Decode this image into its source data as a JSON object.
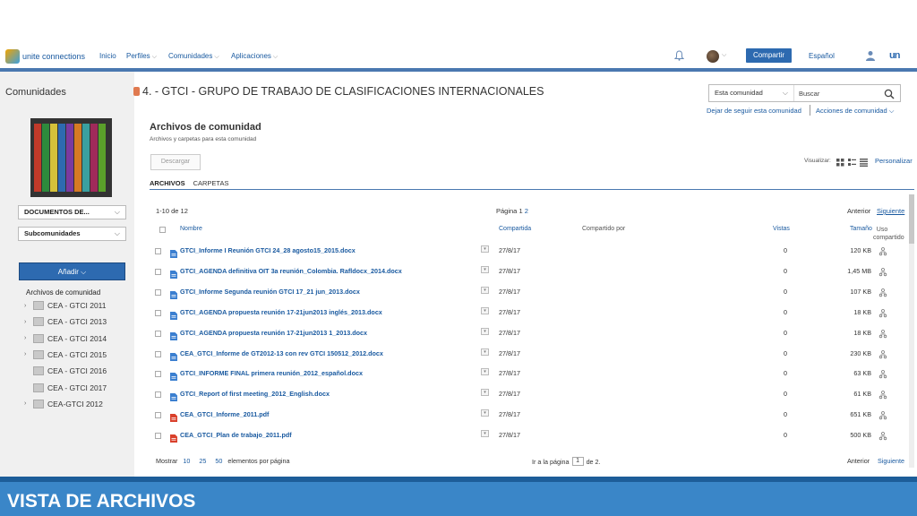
{
  "nav": {
    "logo_text": "unite connections",
    "items": [
      "Inicio",
      "Perfiles",
      "Comunidades",
      "Aplicaciones"
    ],
    "share_label": "Compartir",
    "language": "Español",
    "brand_glyph": "un"
  },
  "sidebar": {
    "title": "Comunidades",
    "select_docs": "DOCUMENTOS DE...",
    "select_sub": "Subcomunidades",
    "add_label": "Añadir",
    "tree_title": "Archivos de comunidad",
    "tree": [
      {
        "label": "CEA - GTCI 2011",
        "expandable": true
      },
      {
        "label": "CEA - GTCI 2013",
        "expandable": true
      },
      {
        "label": "CEA - GTCI 2014",
        "expandable": true
      },
      {
        "label": "CEA - GTCI 2015",
        "expandable": true
      },
      {
        "label": "CEA - GTCI 2016",
        "expandable": false
      },
      {
        "label": "CEA - GTCI 2017",
        "expandable": false
      },
      {
        "label": "CEA-GTCI 2012",
        "expandable": true
      }
    ]
  },
  "header": {
    "title": "4. - GTCI - GRUPO DE TRABAJO DE CLASIFICACIONES INTERNACIONALES",
    "search_scope": "Esta comunidad",
    "search_placeholder": "Buscar",
    "stop_follow": "Dejar de seguir esta comunidad",
    "community_actions": "Acciones de comunidad"
  },
  "files": {
    "title": "Archivos de comunidad",
    "subtitle": "Archivos y carpetas para esta comunidad",
    "download_label": "Descargar",
    "visualize_label": "Visualizar:",
    "personalize_label": "Personalizar",
    "tabs": [
      "ARCHIVOS",
      "CARPETAS"
    ],
    "range": "1-10 de 12",
    "page_label": "Página",
    "pages": [
      "1",
      "2"
    ],
    "prev_label": "Anterior",
    "next_label": "Siguiente",
    "columns": {
      "name": "Nombre",
      "shared": "Compartida",
      "shared_by": "Compartido por",
      "views": "Vistas",
      "size": "Tamaño",
      "usage": "Uso compartido"
    },
    "rows": [
      {
        "name": "GTCI_Informe I Reunión GTCI 24_28 agosto15_2015.docx",
        "type": "doc",
        "date": "27/8/17",
        "views": "0",
        "size": "120 KB"
      },
      {
        "name": "GTCI_AGENDA definitiva OIT 3a reunión_Colombia. Rafldocx_2014.docx",
        "type": "doc",
        "date": "27/8/17",
        "views": "0",
        "size": "1,45 MB"
      },
      {
        "name": "GTCI_Informe Segunda reunión GTCI 17_21 jun_2013.docx",
        "type": "doc",
        "date": "27/8/17",
        "views": "0",
        "size": "107 KB"
      },
      {
        "name": "GTCI_AGENDA propuesta reunión 17-21jun2013 inglés_2013.docx",
        "type": "doc",
        "date": "27/8/17",
        "views": "0",
        "size": "18 KB"
      },
      {
        "name": "GTCI_AGENDA propuesta reunión 17-21jun2013 1_2013.docx",
        "type": "doc",
        "date": "27/8/17",
        "views": "0",
        "size": "18 KB"
      },
      {
        "name": "CEA_GTCI_Informe de GT2012-13 con rev GTCI 150512_2012.docx",
        "type": "doc",
        "date": "27/8/17",
        "views": "0",
        "size": "230 KB"
      },
      {
        "name": "GTCI_INFORME FINAL primera reunión_2012_español.docx",
        "type": "doc",
        "date": "27/8/17",
        "views": "0",
        "size": "63 KB"
      },
      {
        "name": "GTCI_Report of first meeting_2012_English.docx",
        "type": "doc",
        "date": "27/8/17",
        "views": "0",
        "size": "61 KB"
      },
      {
        "name": "CEA_GTCI_Informe_2011.pdf",
        "type": "pdf",
        "date": "27/8/17",
        "views": "0",
        "size": "651 KB"
      },
      {
        "name": "CEA_GTCI_Plan de trabajo_2011.pdf",
        "type": "pdf",
        "date": "27/8/17",
        "views": "0",
        "size": "500 KB"
      }
    ],
    "footer": {
      "show_label": "Mostrar",
      "page_sizes": [
        "10",
        "25",
        "50"
      ],
      "per_page_label": "elementos por página",
      "goto_label": "Ir a la página",
      "current_page": "1",
      "of_label": "de 2."
    }
  },
  "banner": {
    "text": "VISTA DE ARCHIVOS"
  },
  "colors": {
    "accent": "#2d6ab0",
    "link": "#1a5aa0",
    "banner": "#3a86c8",
    "pdf": "#d9402b",
    "doc": "#3b7fd0"
  }
}
